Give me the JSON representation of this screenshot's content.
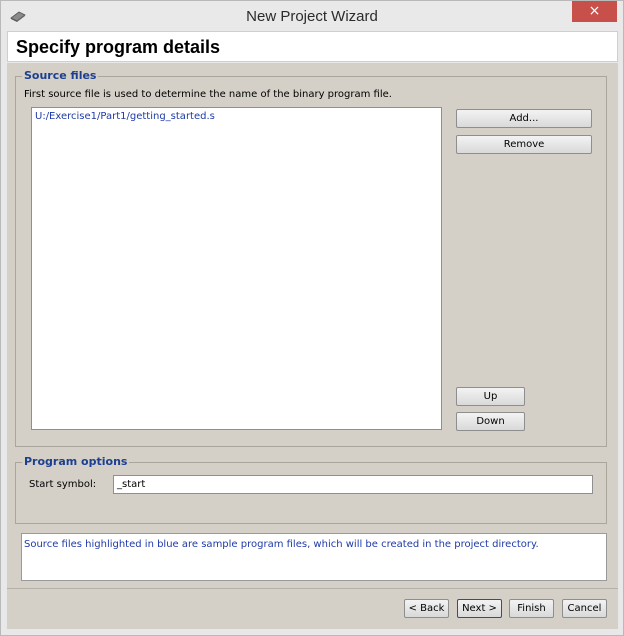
{
  "window": {
    "title": "New Project Wizard",
    "close_glyph": "×"
  },
  "header": {
    "title": "Specify program details"
  },
  "source_files": {
    "legend": "Source files",
    "description": "First source file is used to determine the name of the binary program file.",
    "files": [
      "U:/Exercise1/Part1/getting_started.s"
    ],
    "add_label": "Add...",
    "remove_label": "Remove",
    "up_label": "Up",
    "down_label": "Down"
  },
  "program_options": {
    "legend": "Program options",
    "start_symbol_label": "Start symbol:",
    "start_symbol_value": "_start"
  },
  "info": {
    "text": "Source files highlighted in blue are sample program files, which will be created in the project directory."
  },
  "footer": {
    "back_label": "< Back",
    "next_label": "Next >",
    "finish_label": "Finish",
    "cancel_label": "Cancel"
  },
  "colors": {
    "panel_bg": "#d4d0c8",
    "legend_blue": "#1c3f8f",
    "sample_file_blue": "#1f3aa8",
    "close_red": "#c7504a"
  },
  "icons": {
    "app": "chip-icon"
  }
}
